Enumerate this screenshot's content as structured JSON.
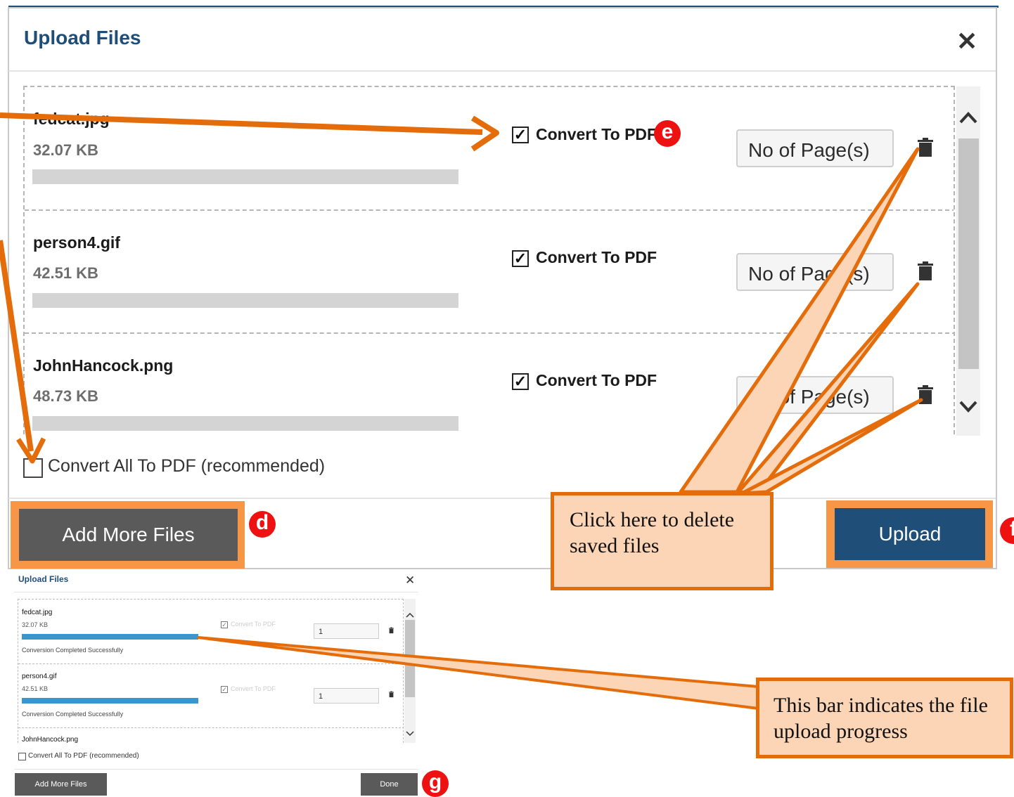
{
  "modal": {
    "title": "Upload Files",
    "close_label": "✕",
    "files": [
      {
        "name": "fedcat.jpg",
        "size": "32.07 KB",
        "convert_label": "Convert To PDF",
        "checked": true,
        "pages_placeholder": "No of Page(s)"
      },
      {
        "name": "person4.gif",
        "size": "42.51 KB",
        "convert_label": "Convert To PDF",
        "checked": true,
        "pages_placeholder": "No of Page(s)"
      },
      {
        "name": "JohnHancock.png",
        "size": "48.73 KB",
        "convert_label": "Convert To PDF",
        "checked": true,
        "pages_placeholder": "No of Page(s)"
      }
    ],
    "convert_all_label": "Convert All To PDF (recommended)",
    "add_more_label": "Add More Files",
    "upload_label": "Upload"
  },
  "markers": {
    "d": "d",
    "e": "e",
    "f": "f",
    "g": "g"
  },
  "callouts": {
    "delete": "Click here to delete saved files",
    "progress": "This bar indicates the file upload progress"
  },
  "small_dialog": {
    "title": "Upload Files",
    "close_label": "✕",
    "files": [
      {
        "name": "fedcat.jpg",
        "size": "32.07 KB",
        "convert_label": "Convert To PDF",
        "pages": "1",
        "progress": 1.0,
        "status": "Conversion Completed Successfully"
      },
      {
        "name": "person4.gif",
        "size": "42.51 KB",
        "convert_label": "Convert To PDF",
        "pages": "1",
        "progress": 1.0,
        "status": "Conversion Completed Successfully"
      },
      {
        "name": "JohnHancock.png"
      }
    ],
    "convert_all_label": "Convert All To PDF (recommended)",
    "add_more_label": "Add More Files",
    "done_label": "Done"
  },
  "colors": {
    "accent": "#1f4e79",
    "annotation": "#e46c0a",
    "callout_fill": "#fbd5b5",
    "marker": "#ee1111",
    "progress": "#3a96cf"
  },
  "icons": {
    "close": "close-icon",
    "trash": "trash-icon",
    "chevron_up": "chevron-up-icon",
    "chevron_down": "chevron-down-icon",
    "checkbox": "checkbox-icon"
  }
}
